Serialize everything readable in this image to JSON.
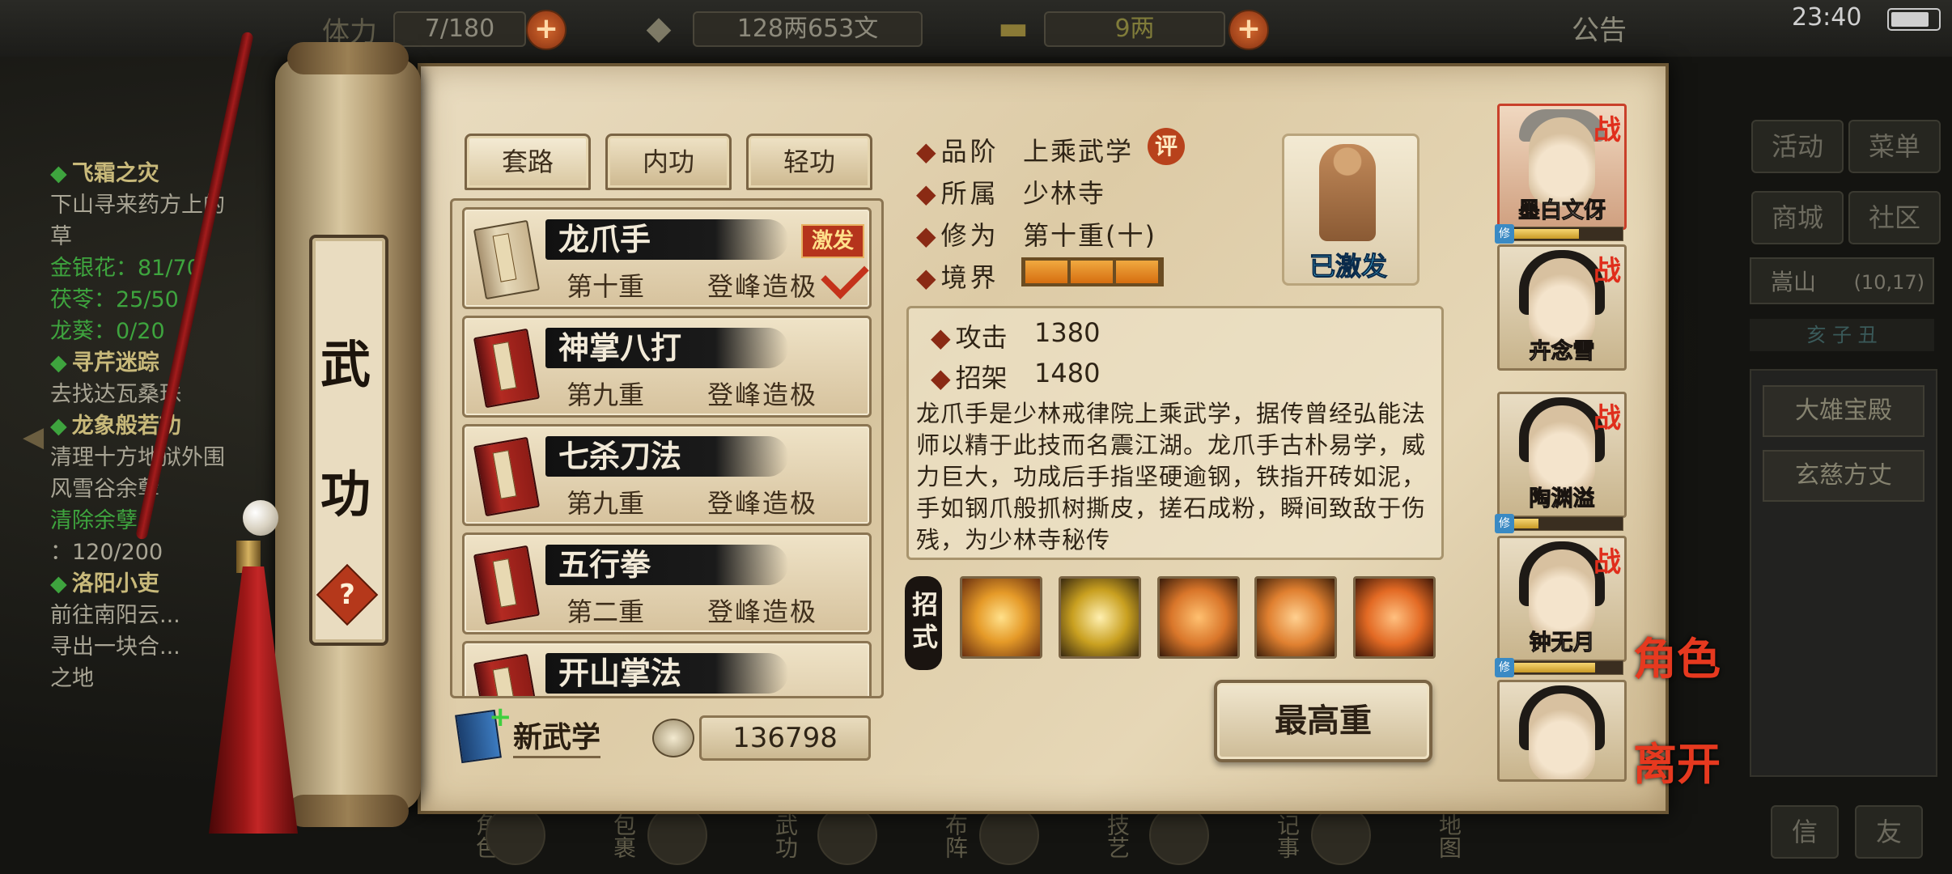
{
  "topbar": {
    "stamina_label": "体力",
    "stamina_value": "7/180",
    "money_value": "128两653文",
    "gold_value": "9两",
    "notice_label": "公告",
    "clock": "23:40"
  },
  "quests": [
    {
      "title": "飞霜之灾",
      "lines": [
        "下山寻来药方上的",
        "草"
      ],
      "items": [
        "金银花：81/70",
        "茯苓：25/50",
        "龙葵：0/20"
      ]
    },
    {
      "title": "寻芹迷踪",
      "lines": [
        "去找达瓦桑珠"
      ]
    },
    {
      "title": "龙象般若功",
      "lines": [
        "清理十方地狱外围",
        "风雪谷余孽"
      ],
      "items": [
        "清除余孽",
        "：120/200"
      ]
    },
    {
      "title": "洛阳小吏",
      "lines": [
        "前往南阳云...",
        "寻出一块合...",
        "之地"
      ]
    }
  ],
  "right_panel": {
    "buttons": [
      "活动",
      "菜单",
      "商城",
      "社区"
    ],
    "location": "嵩山",
    "location_coords": "(10,17)",
    "time_marks": "亥 子 丑",
    "npc_items": [
      "大雄宝殿",
      "玄慈方丈"
    ],
    "bottom_buttons": [
      "信",
      "友"
    ]
  },
  "bottom_nav": [
    "角色",
    "包裹",
    "武功",
    "布阵",
    "技艺",
    "记事",
    "地图"
  ],
  "scroll_title": [
    "武",
    "功"
  ],
  "help_symbol": "?",
  "tabs": [
    "套路",
    "内功",
    "轻功"
  ],
  "skills": [
    {
      "name": "龙爪手",
      "level": "第十重",
      "rank": "登峰造极",
      "badge": "激发",
      "equipped": true
    },
    {
      "name": "神掌八打",
      "level": "第九重",
      "rank": "登峰造极"
    },
    {
      "name": "七杀刀法",
      "level": "第九重",
      "rank": "登峰造极"
    },
    {
      "name": "五行拳",
      "level": "第二重",
      "rank": "登峰造极"
    },
    {
      "name": "开山掌法",
      "level": "",
      "rank": ""
    }
  ],
  "new_skill_label": "新武学",
  "skill_points": "136798",
  "info": {
    "grade_label": "品阶",
    "grade_value": "上乘武学",
    "eval_badge": "评",
    "sect_label": "所属",
    "sect_value": "少林寺",
    "cult_label": "修为",
    "cult_value": "第十重(十)",
    "realm_label": "境界",
    "realm_level": 3,
    "realm_max": 3,
    "activated_label": "已激发"
  },
  "stats": {
    "attack_label": "攻击",
    "attack_value": "1380",
    "parry_label": "招架",
    "parry_value": "1480"
  },
  "description": "龙爪手是少林戒律院上乘武学，据传曾经弘能法师以精于此技而名震江湖。龙爪手古朴易学，威力巨大，功成后手指坚硬逾钢，铁指开砖如泥，手如钢爪般抓树撕皮，搓石成粉，瞬间致敌于伤残，为少林寺秘传",
  "moves_label": "招式",
  "moves": [
    {
      "icon": "golden-swirl-icon",
      "color": "#e59a28"
    },
    {
      "icon": "buddha-char-icon",
      "color": "#c9a020"
    },
    {
      "icon": "claw-strike-icon",
      "color": "#d9762a"
    },
    {
      "icon": "fire-claw-icon",
      "color": "#e08030"
    },
    {
      "icon": "flame-burst-icon",
      "color": "#e36a24"
    }
  ],
  "max_button": "最高重",
  "characters": [
    {
      "name": "墨白文伢",
      "battle": "战",
      "selected": true,
      "bald": true
    },
    {
      "name": "卉念雪",
      "battle": "战"
    },
    {
      "name": "陶渊溢",
      "battle": "战"
    },
    {
      "name": "钟无月",
      "battle": "战"
    },
    {
      "name": "",
      "battle": ""
    }
  ],
  "side_actions": [
    "角色",
    "离开"
  ],
  "colors": {
    "accent_red": "#c4321b",
    "activated_blue": "#4fd2ff",
    "parchment": "#e6d7b6"
  }
}
